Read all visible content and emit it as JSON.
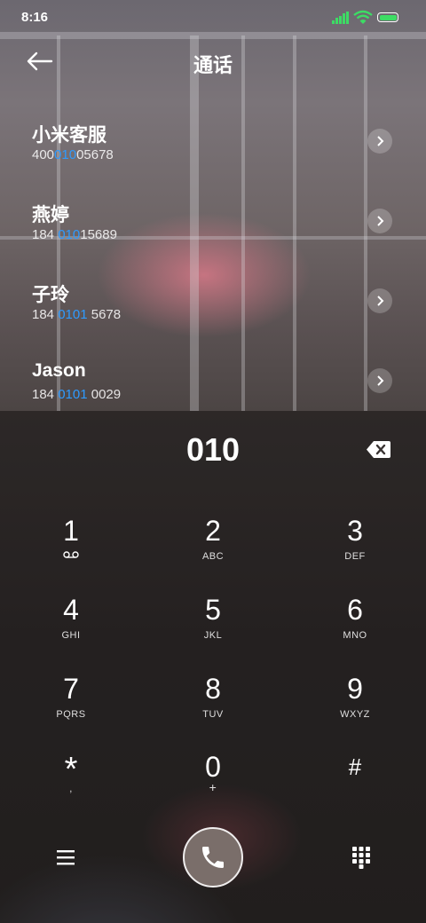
{
  "status_bar": {
    "time": "8:16",
    "battery_color": "#3ddc64"
  },
  "header": {
    "title": "通话"
  },
  "contacts": [
    {
      "name": "小米客服",
      "num_pre": "400",
      "num_match": "010",
      "num_post": "05678"
    },
    {
      "name": "燕婷",
      "num_pre": "184 ",
      "num_match": "010",
      "num_post": "15689"
    },
    {
      "name": "子玲",
      "num_pre": "184 ",
      "num_match": "0101",
      "num_post": " 5678"
    },
    {
      "name": "Jason",
      "num_pre": "184 ",
      "num_match": "0101",
      "num_post": " 0029"
    }
  ],
  "dialer": {
    "input": "010",
    "keys": [
      {
        "digit": "1",
        "letters": ""
      },
      {
        "digit": "2",
        "letters": "ABC"
      },
      {
        "digit": "3",
        "letters": "DEF"
      },
      {
        "digit": "4",
        "letters": "GHI"
      },
      {
        "digit": "5",
        "letters": "JKL"
      },
      {
        "digit": "6",
        "letters": "MNO"
      },
      {
        "digit": "7",
        "letters": "PQRS"
      },
      {
        "digit": "8",
        "letters": "TUV"
      },
      {
        "digit": "9",
        "letters": "WXYZ"
      },
      {
        "digit": "*",
        "letters": ","
      },
      {
        "digit": "0",
        "letters": "+"
      },
      {
        "digit": "#",
        "letters": ""
      }
    ]
  },
  "colors": {
    "match_highlight": "#2e9bff",
    "call_button": "#7a6e6a"
  },
  "icons": [
    "back-arrow-icon",
    "chevron-right-icon",
    "backspace-icon",
    "voicemail-icon",
    "menu-icon",
    "phone-icon",
    "dialpad-icon"
  ]
}
